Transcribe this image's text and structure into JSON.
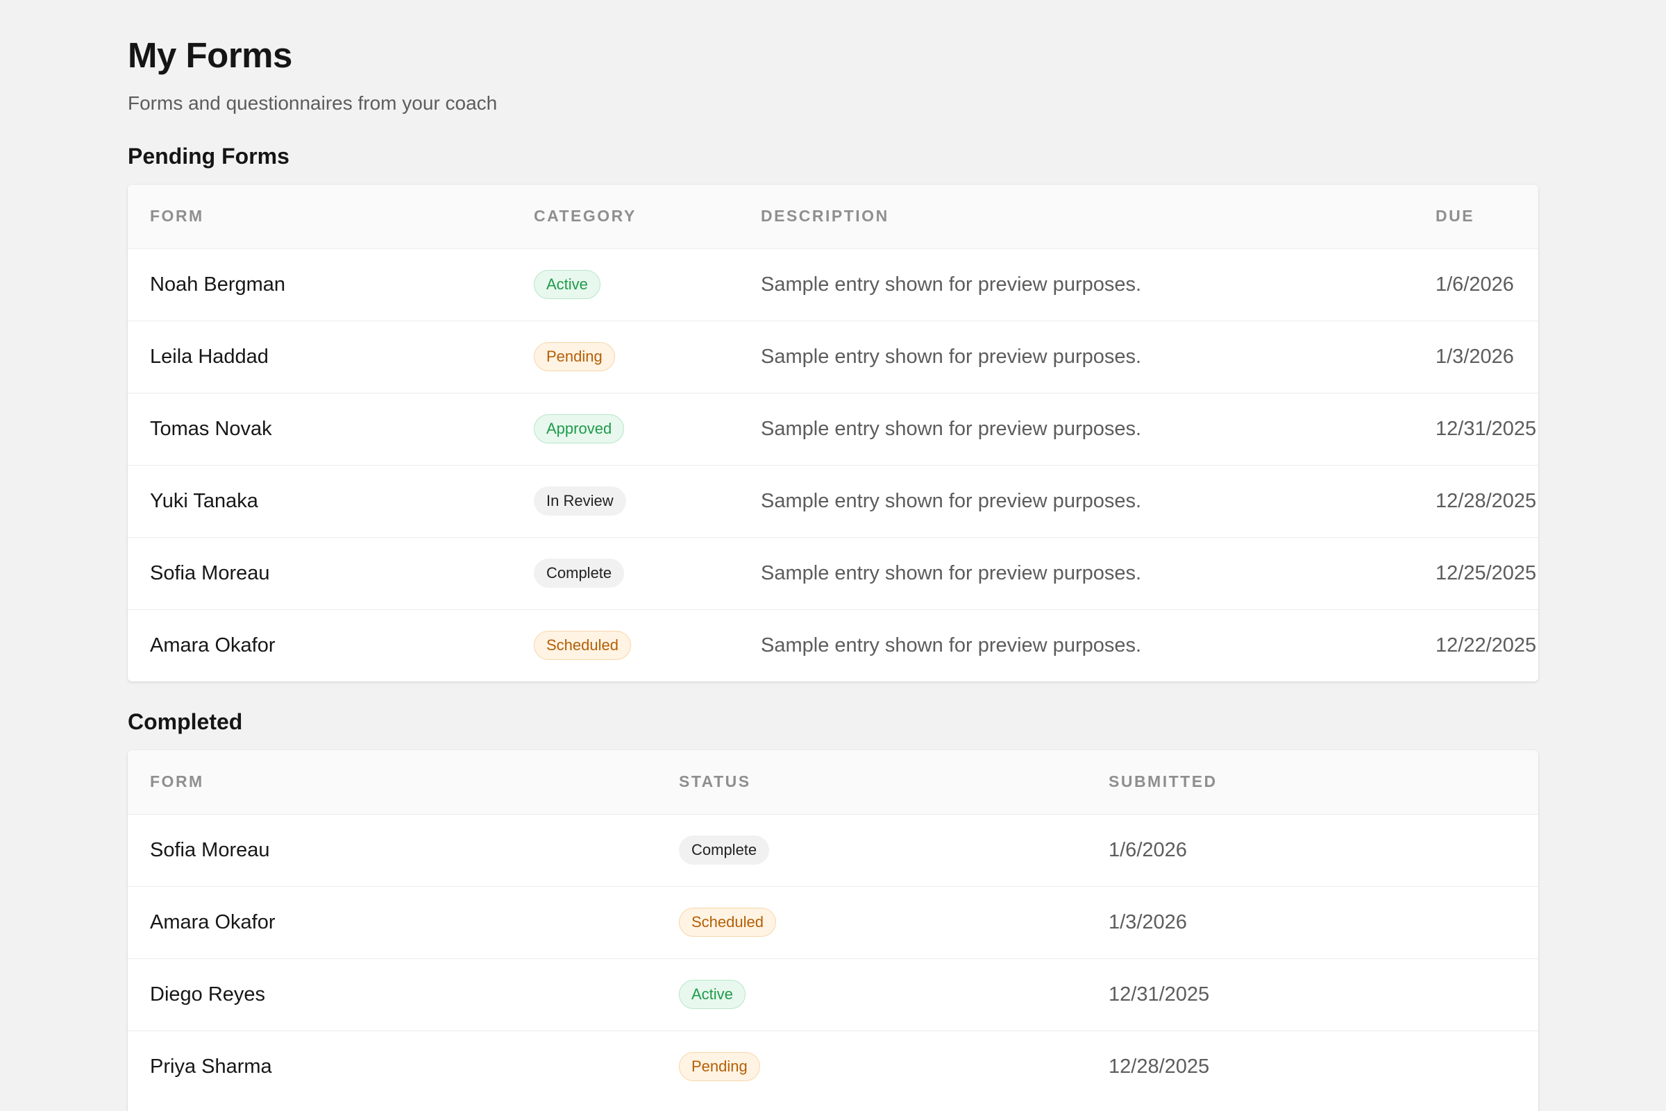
{
  "header": {
    "title": "My Forms",
    "subtitle": "Forms and questionnaires from your coach"
  },
  "pending": {
    "title": "Pending Forms",
    "columns": {
      "form": "FORM",
      "category": "CATEGORY",
      "description": "DESCRIPTION",
      "due": "DUE"
    },
    "rows": [
      {
        "form": "Noah Bergman",
        "category": "Active",
        "tone": "green",
        "description": "Sample entry shown for preview purposes.",
        "due": "1/6/2026"
      },
      {
        "form": "Leila Haddad",
        "category": "Pending",
        "tone": "orange",
        "description": "Sample entry shown for preview purposes.",
        "due": "1/3/2026"
      },
      {
        "form": "Tomas Novak",
        "category": "Approved",
        "tone": "green",
        "description": "Sample entry shown for preview purposes.",
        "due": "12/31/2025"
      },
      {
        "form": "Yuki Tanaka",
        "category": "In Review",
        "tone": "gray",
        "description": "Sample entry shown for preview purposes.",
        "due": "12/28/2025"
      },
      {
        "form": "Sofia Moreau",
        "category": "Complete",
        "tone": "gray",
        "description": "Sample entry shown for preview purposes.",
        "due": "12/25/2025"
      },
      {
        "form": "Amara Okafor",
        "category": "Scheduled",
        "tone": "orange",
        "description": "Sample entry shown for preview purposes.",
        "due": "12/22/2025"
      }
    ]
  },
  "completed": {
    "title": "Completed",
    "columns": {
      "form": "FORM",
      "status": "STATUS",
      "submitted": "SUBMITTED"
    },
    "rows": [
      {
        "form": "Sofia Moreau",
        "status": "Complete",
        "tone": "gray",
        "submitted": "1/6/2026"
      },
      {
        "form": "Amara Okafor",
        "status": "Scheduled",
        "tone": "orange",
        "submitted": "1/3/2026"
      },
      {
        "form": "Diego Reyes",
        "status": "Active",
        "tone": "green",
        "submitted": "12/31/2025"
      },
      {
        "form": "Priya Sharma",
        "status": "Pending",
        "tone": "orange",
        "submitted": "12/28/2025"
      }
    ]
  },
  "colors": {
    "background": "#f2f2f2",
    "card": "#ffffff",
    "green": "#1f9a4a",
    "orange": "#b45f06"
  }
}
